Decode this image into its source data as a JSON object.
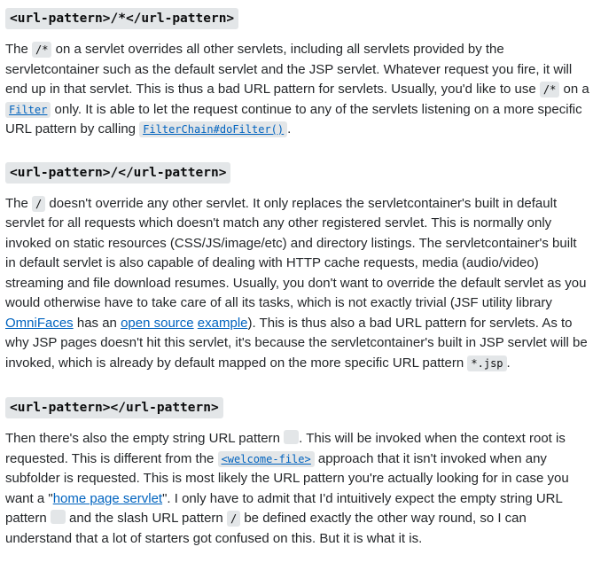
{
  "sections": [
    {
      "heading": "<url-pattern>/*</url-pattern>",
      "parts": [
        {
          "t": "text",
          "v": "The "
        },
        {
          "t": "code",
          "v": "/*"
        },
        {
          "t": "text",
          "v": " on a servlet overrides all other servlets, including all servlets provided by the servletcontainer such as the default servlet and the JSP servlet. Whatever request you fire, it will end up in that servlet. This is thus a bad URL pattern for servlets. Usually, you'd like to use "
        },
        {
          "t": "code",
          "v": "/*"
        },
        {
          "t": "text",
          "v": " on a "
        },
        {
          "t": "codelink",
          "v": "Filter"
        },
        {
          "t": "text",
          "v": " only. It is able to let the request continue to any of the servlets listening on a more specific URL pattern by calling "
        },
        {
          "t": "codelink",
          "v": "FilterChain#doFilter()"
        },
        {
          "t": "text",
          "v": "."
        }
      ]
    },
    {
      "heading": "<url-pattern>/</url-pattern>",
      "parts": [
        {
          "t": "text",
          "v": "The "
        },
        {
          "t": "code",
          "v": "/"
        },
        {
          "t": "text",
          "v": " doesn't override any other servlet. It only replaces the servletcontainer's built in default servlet for all requests which doesn't match any other registered servlet. This is normally only invoked on static resources (CSS/JS/image/etc) and directory listings. The servletcontainer's built in default servlet is also capable of dealing with HTTP cache requests, media (audio/video) streaming and file download resumes. Usually, you don't want to override the default servlet as you would otherwise have to take care of all its tasks, which is not exactly trivial (JSF utility library "
        },
        {
          "t": "link",
          "v": "OmniFaces"
        },
        {
          "t": "text",
          "v": " has an "
        },
        {
          "t": "link",
          "v": "open source"
        },
        {
          "t": "text",
          "v": " "
        },
        {
          "t": "link",
          "v": "example"
        },
        {
          "t": "text",
          "v": "). This is thus also a bad URL pattern for servlets. As to why JSP pages doesn't hit this servlet, it's because the servletcontainer's built in JSP servlet will be invoked, which is already by default mapped on the more specific URL pattern "
        },
        {
          "t": "code",
          "v": "*.jsp"
        },
        {
          "t": "text",
          "v": "."
        }
      ]
    },
    {
      "heading": "<url-pattern></url-pattern>",
      "parts": [
        {
          "t": "text",
          "v": "Then there's also the empty string URL pattern "
        },
        {
          "t": "code",
          "v": ""
        },
        {
          "t": "text",
          "v": ". This will be invoked when the context root is requested. This is different from the "
        },
        {
          "t": "codelink",
          "v": "<welcome-file>"
        },
        {
          "t": "text",
          "v": " approach that it isn't invoked when any subfolder is requested. This is most likely the URL pattern you're actually looking for in case you want a \""
        },
        {
          "t": "link",
          "v": "home page servlet"
        },
        {
          "t": "text",
          "v": "\". I only have to admit that I'd intuitively expect the empty string URL pattern "
        },
        {
          "t": "code",
          "v": ""
        },
        {
          "t": "text",
          "v": " and the slash URL pattern "
        },
        {
          "t": "code",
          "v": "/"
        },
        {
          "t": "text",
          "v": " be defined exactly the other way round, so I can understand that a lot of starters got confused on this. But it is what it is."
        }
      ]
    }
  ]
}
